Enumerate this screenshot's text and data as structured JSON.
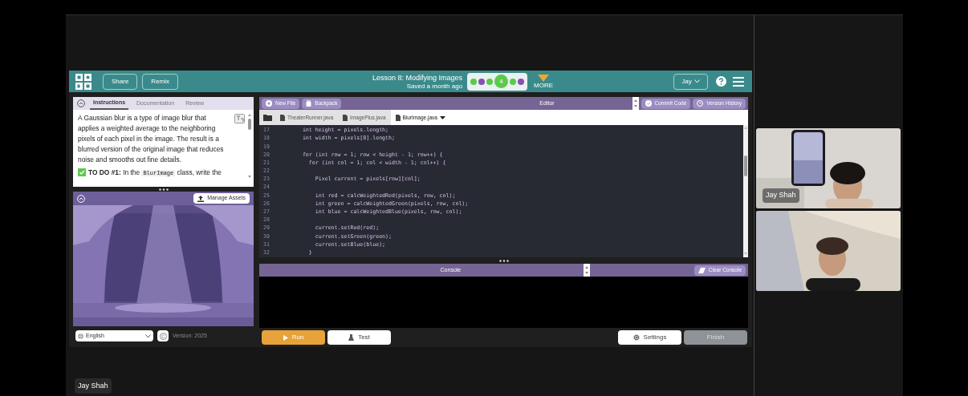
{
  "topbar": {
    "buttons": [
      "Share",
      "Remix"
    ],
    "lesson_title": "Lesson 8: Modifying Images",
    "saved": "Saved a month ago",
    "progress": [
      {
        "color": "#5cc94c",
        "selected": false
      },
      {
        "color": "#8a4fb0",
        "selected": false
      },
      {
        "color": "#5cc94c",
        "selected": false
      },
      {
        "color": "#5cc94c",
        "selected": true,
        "label": "4"
      },
      {
        "color": "#5cc94c",
        "selected": false
      },
      {
        "color": "#8a4fb0",
        "selected": false
      }
    ],
    "more": "MORE",
    "user": "Jay"
  },
  "instructions": {
    "tabs": [
      {
        "label": "Instructions",
        "selected": true
      },
      {
        "label": "Documentation",
        "selected": false
      },
      {
        "label": "Review",
        "selected": false
      }
    ],
    "text": "A Gaussian blur is a type of image blur that applies a weighted average to the neighboring pixels of each pixel in the image. The result is a blurred version of the original image that reduces noise and smooths out fine details.",
    "todo": {
      "done": true,
      "lead": "**TO DO #1:** In the",
      "code": "BlurImage",
      "rest": "class, write the"
    }
  },
  "stage": {
    "manage_assets": "Manage Assets",
    "language": "English",
    "version": "Version: 2025"
  },
  "editor": {
    "new_file": "New File",
    "backpack": "Backpack",
    "title": "Editor",
    "commit": "Commit Code",
    "history": "Version History",
    "files": [
      {
        "name": "TheaterRunner.java",
        "selected": false
      },
      {
        "name": "ImagePlus.java",
        "selected": false
      },
      {
        "name": "BlurImage.java",
        "selected": true
      }
    ],
    "lines": [
      {
        "n": "17",
        "code": "    int height = pixels.length;"
      },
      {
        "n": "18",
        "code": "    int width = pixels[0].length;"
      },
      {
        "n": "19"
      },
      {
        "n": "20",
        "code": "    for (int row = 1; row < height - 1; row++) {"
      },
      {
        "n": "21",
        "code": "      for (int col = 1; col < width - 1; col++) {"
      },
      {
        "n": "22"
      },
      {
        "n": "23",
        "code": "        Pixel current = pixels[row][col];"
      },
      {
        "n": "24"
      },
      {
        "n": "25",
        "code": "        int red = calcWeightedRed(pixels, row, col);"
      },
      {
        "n": "26",
        "code": "        int green = calcWeightedGreen(pixels, row, col);"
      },
      {
        "n": "27",
        "code": "        int blue = calcWeightedBlue(pixels, row, col);"
      },
      {
        "n": "28"
      },
      {
        "n": "29",
        "code": "        current.setRed(red);"
      },
      {
        "n": "30",
        "code": "        current.setGreen(green);"
      },
      {
        "n": "31",
        "code": "        current.setBlue(blue);"
      },
      {
        "n": "32",
        "code": "      }"
      }
    ]
  },
  "console": {
    "title": "Console",
    "clear": "Clear Console"
  },
  "actions": {
    "run": "Run",
    "test": "Test",
    "settings": "Settings",
    "finish": "Finish"
  },
  "videos": [
    {
      "kind": "picture",
      "name": "Jay Shah"
    },
    {
      "kind": "picture"
    }
  ],
  "presenter": "Jay Shah"
}
